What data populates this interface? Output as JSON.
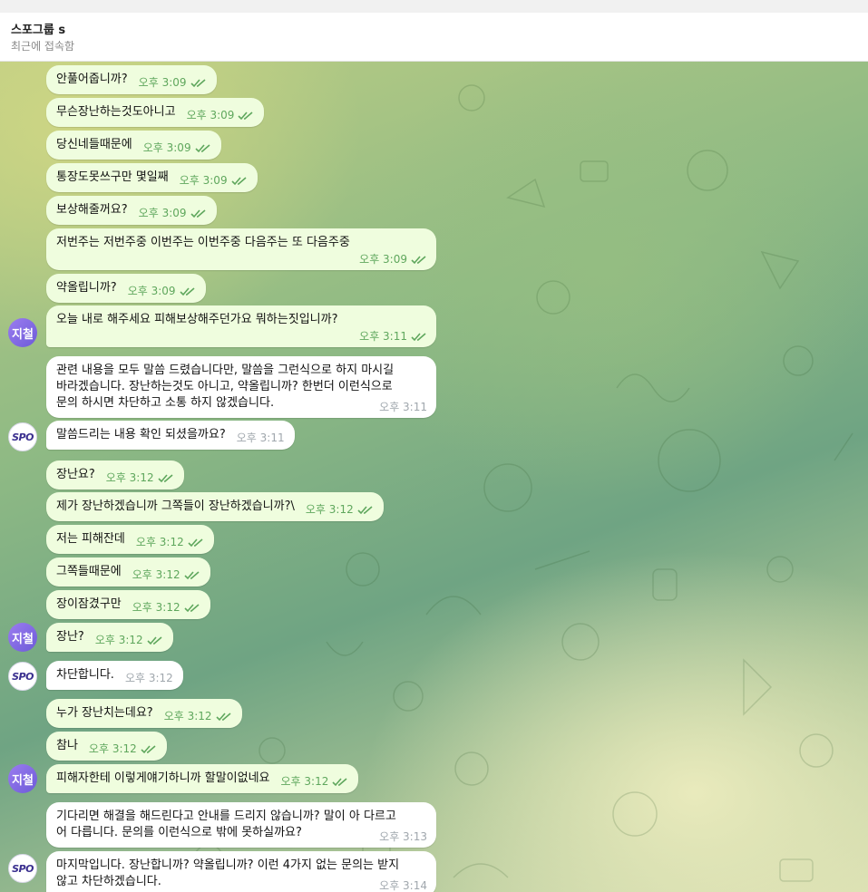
{
  "header": {
    "title": "스포그룹 s",
    "status": "최근에 접속함"
  },
  "avatars": {
    "user_label": "지철",
    "brand_label": "SPO"
  },
  "messages": [
    {
      "text": "안풀어줍니까?",
      "time": "오후 3:09"
    },
    {
      "text": "무슨장난하는것도아니고",
      "time": "오후 3:09"
    },
    {
      "text": "당신네들때문에",
      "time": "오후 3:09"
    },
    {
      "text": "통장도못쓰구만 몇일째",
      "time": "오후 3:09"
    },
    {
      "text": "보상해줄꺼요?",
      "time": "오후 3:09"
    },
    {
      "text": "저번주는 저번주중 이번주는 이번주중 다음주는 또 다음주중",
      "time": "오후 3:09"
    },
    {
      "text": "약올립니까?",
      "time": "오후 3:09"
    },
    {
      "text": "오늘 내로 해주세요 피해보상해주던가요 뭐하는짓입니까?",
      "time": "오후 3:11"
    },
    {
      "text": "관련 내용을 모두 말씀 드렸습니다만, 말씀을 그런식으로 하지 마시길\n바라겠습니다. 장난하는것도 아니고, 약올립니까? 한번더 이런식으로\n문의 하시면 차단하고 소통 하지 않겠습니다.",
      "time": "오후 3:11"
    },
    {
      "text": "말씀드리는 내용 확인 되셨을까요?",
      "time": "오후 3:11"
    },
    {
      "text": "장난요?",
      "time": "오후 3:12"
    },
    {
      "text": "제가 장난하겠습니까 그쪽들이 장난하겠습니까?\\",
      "time": "오후 3:12"
    },
    {
      "text": "저는 피해잔데",
      "time": "오후 3:12"
    },
    {
      "text": "그쪽들때문에",
      "time": "오후 3:12"
    },
    {
      "text": "장이잠겼구만",
      "time": "오후 3:12"
    },
    {
      "text": "장난?",
      "time": "오후 3:12"
    },
    {
      "text": "차단합니다.",
      "time": "오후 3:12"
    },
    {
      "text": "누가 장난치는데요?",
      "time": "오후 3:12"
    },
    {
      "text": "참나",
      "time": "오후 3:12"
    },
    {
      "text": "피해자한테 이렇게얘기하니까 할말이없네요",
      "time": "오후 3:12"
    },
    {
      "text": "기다리면 해결을 해드린다고 안내를 드리지 않습니까? 말이 아 다르고\n어 다릅니다. 문의를 이런식으로 밖에 못하실까요?",
      "time": "오후 3:13"
    },
    {
      "text": "마지막입니다. 장난합니까? 약올립니까? 이런 4가지 없는 문의는 받지\n않고 차단하겠습니다.",
      "time": "오후 3:14"
    }
  ]
}
